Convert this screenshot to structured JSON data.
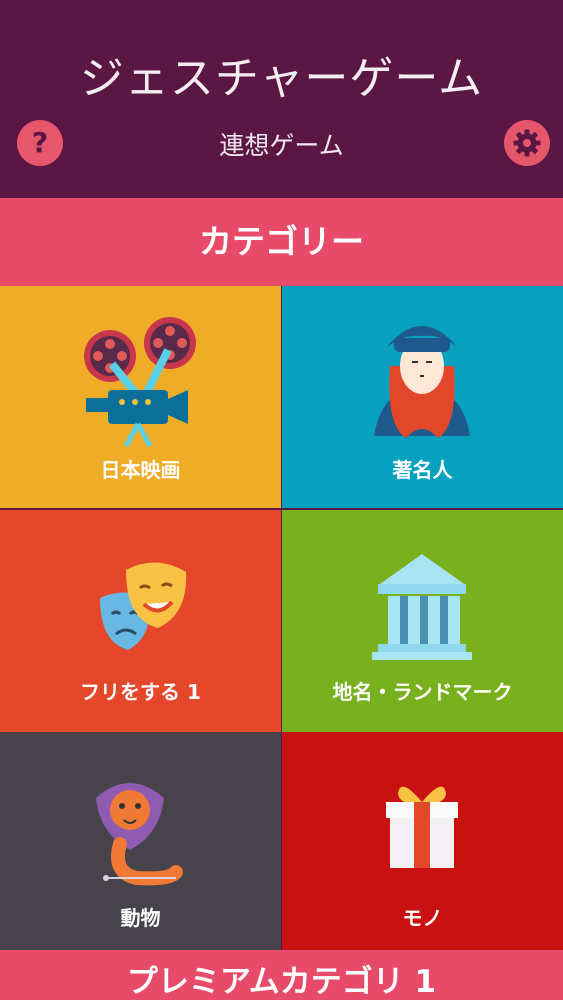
{
  "header": {
    "title": "ジェスチャーゲーム",
    "subtitle": "連想ゲーム",
    "help_icon": "question-mark-icon",
    "settings_icon": "gear-icon"
  },
  "section_category": {
    "label": "カテゴリー"
  },
  "categories": [
    {
      "label": "日本映画",
      "icon": "film-projector-icon",
      "color": "#efac27"
    },
    {
      "label": "著名人",
      "icon": "famous-person-portrait-icon",
      "color": "#07a1bf"
    },
    {
      "label": "フリをする 1",
      "icon": "theater-masks-icon",
      "color": "#e5472a"
    },
    {
      "label": "地名・ランドマーク",
      "icon": "classical-building-icon",
      "color": "#79b01d"
    },
    {
      "label": "動物",
      "icon": "lion-snake-icon",
      "color": "#47434b"
    },
    {
      "label": "モノ",
      "icon": "gift-box-icon",
      "color": "#c91112"
    }
  ],
  "section_premium": {
    "label": "プレミアムカテゴリ 1"
  },
  "colors": {
    "header_bg": "#5a1743",
    "accent": "#e84a6a",
    "icon_button": "#e7576b"
  }
}
